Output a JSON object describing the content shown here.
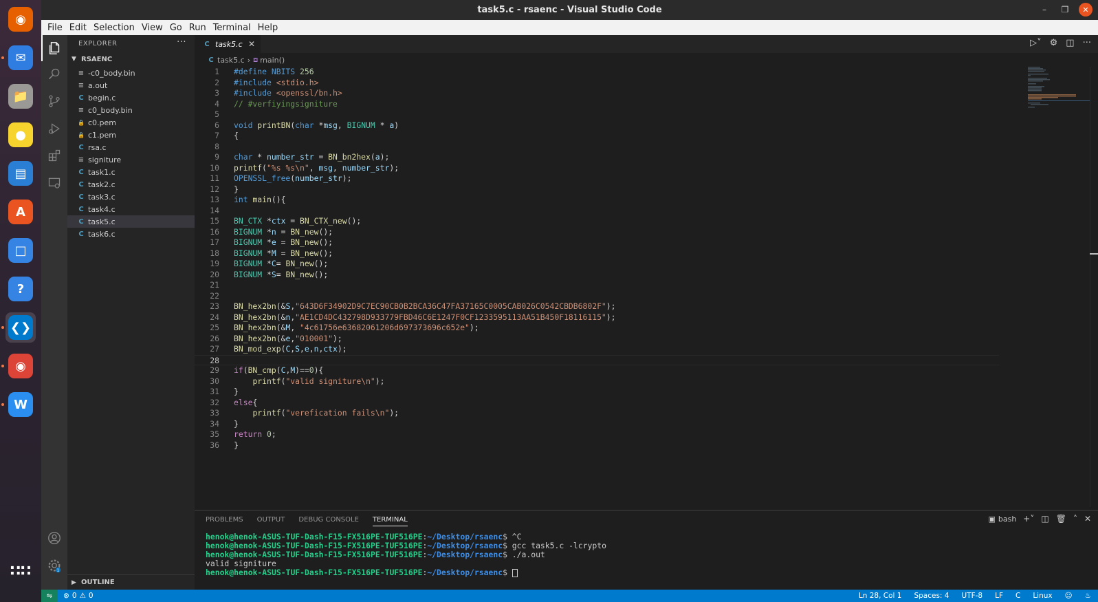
{
  "window": {
    "title": "task5.c - rsaenc - Visual Studio Code"
  },
  "menu": [
    "File",
    "Edit",
    "Selection",
    "View",
    "Go",
    "Run",
    "Terminal",
    "Help"
  ],
  "dock": [
    {
      "name": "firefox-icon",
      "color": "#e66000"
    },
    {
      "name": "thunderbird-icon",
      "color": "#2f7de1"
    },
    {
      "name": "files-icon",
      "color": "#9a9996"
    },
    {
      "name": "rhythmbox-icon",
      "color": "#f6d32d"
    },
    {
      "name": "writer-icon",
      "color": "#2a7fd4"
    },
    {
      "name": "app-center-icon",
      "color": "#e95420"
    },
    {
      "name": "screenshot-icon",
      "color": "#3584e4"
    },
    {
      "name": "help-icon",
      "color": "#3584e4"
    },
    {
      "name": "vscode-icon",
      "color": "#007acc"
    },
    {
      "name": "chrome-icon",
      "color": "#db4437"
    },
    {
      "name": "wps-icon",
      "color": "#2b8ff1"
    },
    {
      "name": "show-apps-icon",
      "color": "#ffffff"
    }
  ],
  "explorer": {
    "header": "EXPLORER",
    "folder": "RSAENC",
    "files": [
      {
        "name": "-c0_body.bin",
        "type": "lines"
      },
      {
        "name": "a.out",
        "type": "lines"
      },
      {
        "name": "begin.c",
        "type": "c"
      },
      {
        "name": "c0_body.bin",
        "type": "lines"
      },
      {
        "name": "c0.pem",
        "type": "lock"
      },
      {
        "name": "c1.pem",
        "type": "lock"
      },
      {
        "name": "rsa.c",
        "type": "c"
      },
      {
        "name": "signiture",
        "type": "lines"
      },
      {
        "name": "task1.c",
        "type": "c"
      },
      {
        "name": "task2.c",
        "type": "c"
      },
      {
        "name": "task3.c",
        "type": "c"
      },
      {
        "name": "task4.c",
        "type": "c"
      },
      {
        "name": "task5.c",
        "type": "c",
        "selected": true
      },
      {
        "name": "task6.c",
        "type": "c"
      }
    ],
    "outline": "OUTLINE"
  },
  "editor": {
    "tab": "task5.c",
    "breadcrumb_file": "task5.c",
    "breadcrumb_symbol": "main()",
    "current_line": 28,
    "lines": [
      [
        [
          "pp",
          "#define "
        ],
        [
          "macro",
          "NBITS "
        ],
        [
          "num",
          "256"
        ]
      ],
      [
        [
          "pp",
          "#include "
        ],
        [
          "str",
          "<stdio.h>"
        ]
      ],
      [
        [
          "pp",
          "#include "
        ],
        [
          "str",
          "<openssl/bn.h>"
        ]
      ],
      [
        [
          "cm",
          "// #verfiyingsigniture"
        ]
      ],
      [],
      [
        [
          "kw",
          "void "
        ],
        [
          "fn",
          "printBN"
        ],
        [
          "pl",
          "("
        ],
        [
          "kw",
          "char "
        ],
        [
          "pl",
          "*"
        ],
        [
          "var",
          "msg"
        ],
        [
          "pl",
          ", "
        ],
        [
          "type",
          "BIGNUM "
        ],
        [
          "pl",
          "* "
        ],
        [
          "var",
          "a"
        ],
        [
          "pl",
          ")"
        ]
      ],
      [
        [
          "pl",
          "{"
        ]
      ],
      [],
      [
        [
          "kw",
          "char "
        ],
        [
          "pl",
          "* "
        ],
        [
          "var",
          "number_str"
        ],
        [
          "pl",
          " = "
        ],
        [
          "fn",
          "BN_bn2hex"
        ],
        [
          "pl",
          "("
        ],
        [
          "var",
          "a"
        ],
        [
          "pl",
          ");"
        ]
      ],
      [
        [
          "fn",
          "printf"
        ],
        [
          "pl",
          "("
        ],
        [
          "str",
          "\"%s %s\\n\""
        ],
        [
          "pl",
          ", "
        ],
        [
          "var",
          "msg"
        ],
        [
          "pl",
          ", "
        ],
        [
          "var",
          "number_str"
        ],
        [
          "pl",
          ");"
        ]
      ],
      [
        [
          "macro",
          "OPENSSL_free"
        ],
        [
          "pl",
          "("
        ],
        [
          "var",
          "number_str"
        ],
        [
          "pl",
          ");"
        ]
      ],
      [
        [
          "pl",
          "}"
        ]
      ],
      [
        [
          "kw",
          "int "
        ],
        [
          "fn",
          "main"
        ],
        [
          "pl",
          "(){"
        ]
      ],
      [],
      [
        [
          "type",
          "BN_CTX "
        ],
        [
          "pl",
          "*"
        ],
        [
          "var",
          "ctx"
        ],
        [
          "pl",
          " = "
        ],
        [
          "fn",
          "BN_CTX_new"
        ],
        [
          "pl",
          "();"
        ]
      ],
      [
        [
          "type",
          "BIGNUM "
        ],
        [
          "pl",
          "*"
        ],
        [
          "var",
          "n"
        ],
        [
          "pl",
          " = "
        ],
        [
          "fn",
          "BN_new"
        ],
        [
          "pl",
          "();"
        ]
      ],
      [
        [
          "type",
          "BIGNUM "
        ],
        [
          "pl",
          "*"
        ],
        [
          "var",
          "e"
        ],
        [
          "pl",
          " = "
        ],
        [
          "fn",
          "BN_new"
        ],
        [
          "pl",
          "();"
        ]
      ],
      [
        [
          "type",
          "BIGNUM "
        ],
        [
          "pl",
          "*"
        ],
        [
          "var",
          "M"
        ],
        [
          "pl",
          " = "
        ],
        [
          "fn",
          "BN_new"
        ],
        [
          "pl",
          "();"
        ]
      ],
      [
        [
          "type",
          "BIGNUM "
        ],
        [
          "pl",
          "*"
        ],
        [
          "var",
          "C"
        ],
        [
          "pl",
          "= "
        ],
        [
          "fn",
          "BN_new"
        ],
        [
          "pl",
          "();"
        ]
      ],
      [
        [
          "type",
          "BIGNUM "
        ],
        [
          "pl",
          "*"
        ],
        [
          "var",
          "S"
        ],
        [
          "pl",
          "= "
        ],
        [
          "fn",
          "BN_new"
        ],
        [
          "pl",
          "();"
        ]
      ],
      [],
      [],
      [
        [
          "fn",
          "BN_hex2bn"
        ],
        [
          "pl",
          "(&"
        ],
        [
          "var",
          "S"
        ],
        [
          "pl",
          ","
        ],
        [
          "str",
          "\"643D6F34902D9C7EC90CB0B2BCA36C47FA37165C0005CAB026C0542CBDB6802F\""
        ],
        [
          "pl",
          ");"
        ]
      ],
      [
        [
          "fn",
          "BN_hex2bn"
        ],
        [
          "pl",
          "(&"
        ],
        [
          "var",
          "n"
        ],
        [
          "pl",
          ","
        ],
        [
          "str",
          "\"AE1CD4DC432798D933779FBD46C6E1247F0CF1233595113AA51B450F18116115\""
        ],
        [
          "pl",
          ");"
        ]
      ],
      [
        [
          "fn",
          "BN_hex2bn"
        ],
        [
          "pl",
          "(&"
        ],
        [
          "var",
          "M"
        ],
        [
          "pl",
          ", "
        ],
        [
          "str",
          "\"4c61756e63682061206d697373696c652e\""
        ],
        [
          "pl",
          ");"
        ]
      ],
      [
        [
          "fn",
          "BN_hex2bn"
        ],
        [
          "pl",
          "(&"
        ],
        [
          "var",
          "e"
        ],
        [
          "pl",
          ","
        ],
        [
          "str",
          "\"010001\""
        ],
        [
          "pl",
          ");"
        ]
      ],
      [
        [
          "fn",
          "BN_mod_exp"
        ],
        [
          "pl",
          "("
        ],
        [
          "var",
          "C"
        ],
        [
          "pl",
          ","
        ],
        [
          "var",
          "S"
        ],
        [
          "pl",
          ","
        ],
        [
          "var",
          "e"
        ],
        [
          "pl",
          ","
        ],
        [
          "var",
          "n"
        ],
        [
          "pl",
          ","
        ],
        [
          "var",
          "ctx"
        ],
        [
          "pl",
          ");"
        ]
      ],
      [],
      [
        [
          "ctl",
          "if"
        ],
        [
          "pl",
          "("
        ],
        [
          "fn",
          "BN_cmp"
        ],
        [
          "pl",
          "("
        ],
        [
          "var",
          "C"
        ],
        [
          "pl",
          ","
        ],
        [
          "var",
          "M"
        ],
        [
          "pl",
          ")=="
        ],
        [
          "num",
          "0"
        ],
        [
          "pl",
          "){"
        ]
      ],
      [
        [
          "pl",
          "    "
        ],
        [
          "fn",
          "printf"
        ],
        [
          "pl",
          "("
        ],
        [
          "str",
          "\"valid signiture\\n\""
        ],
        [
          "pl",
          ");"
        ]
      ],
      [
        [
          "pl",
          "}"
        ]
      ],
      [
        [
          "ctl",
          "else"
        ],
        [
          "pl",
          "{"
        ]
      ],
      [
        [
          "pl",
          "    "
        ],
        [
          "fn",
          "printf"
        ],
        [
          "pl",
          "("
        ],
        [
          "str",
          "\"verefication fails\\n\""
        ],
        [
          "pl",
          ");"
        ]
      ],
      [
        [
          "pl",
          "}"
        ]
      ],
      [
        [
          "ctl",
          "return "
        ],
        [
          "num",
          "0"
        ],
        [
          "pl",
          ";"
        ]
      ],
      [
        [
          "pl",
          "}"
        ]
      ]
    ]
  },
  "panel": {
    "tabs": [
      "PROBLEMS",
      "OUTPUT",
      "DEBUG CONSOLE",
      "TERMINAL"
    ],
    "active_tab": "TERMINAL",
    "shell": "bash",
    "terminal": [
      {
        "user": "henok@henok-ASUS-TUF-Dash-F15-FX516PE-TUF516PE",
        "path": "~/Desktop/rsaenc",
        "cmd": "^C"
      },
      {
        "user": "henok@henok-ASUS-TUF-Dash-F15-FX516PE-TUF516PE",
        "path": "~/Desktop/rsaenc",
        "cmd": "gcc task5.c -lcrypto"
      },
      {
        "user": "henok@henok-ASUS-TUF-Dash-F15-FX516PE-TUF516PE",
        "path": "~/Desktop/rsaenc",
        "cmd": "./a.out"
      },
      {
        "output": "valid signiture"
      },
      {
        "user": "henok@henok-ASUS-TUF-Dash-F15-FX516PE-TUF516PE",
        "path": "~/Desktop/rsaenc",
        "cmd": "",
        "cursor": true
      }
    ]
  },
  "status": {
    "errors": "0",
    "warnings": "0",
    "position": "Ln 28, Col 1",
    "spaces": "Spaces: 4",
    "encoding": "UTF-8",
    "eol": "LF",
    "language": "C",
    "platform": "Linux"
  }
}
